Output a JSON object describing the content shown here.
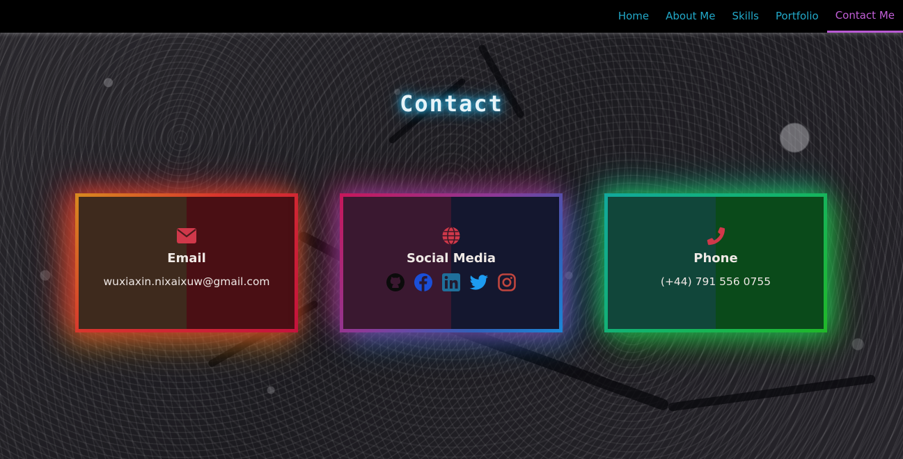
{
  "nav": {
    "items": [
      {
        "label": "Home",
        "active": false
      },
      {
        "label": "About Me",
        "active": false
      },
      {
        "label": "Skills",
        "active": false
      },
      {
        "label": "Portfolio",
        "active": false
      },
      {
        "label": "Contact Me",
        "active": true
      }
    ],
    "link_color": "#22a9c9",
    "active_color": "#c25fd8"
  },
  "page_title": "Contact",
  "cards": [
    {
      "id": "email",
      "icon": "envelope-icon",
      "title": "Email",
      "text": "wuxiaxin.nixaixuw@gmail.com"
    },
    {
      "id": "social",
      "icon": "globe-icon",
      "title": "Social Media",
      "links": [
        {
          "icon": "github-icon",
          "color": "#111111"
        },
        {
          "icon": "facebook-icon",
          "color": "#1a4fd8"
        },
        {
          "icon": "linkedin-icon",
          "color": "#1f6f9a"
        },
        {
          "icon": "twitter-icon",
          "color": "#1d9bf0"
        },
        {
          "icon": "instagram-icon",
          "color": "#c0453e"
        }
      ]
    },
    {
      "id": "phone",
      "icon": "phone-icon",
      "title": "Phone",
      "text": "(+44) 791 556 0755"
    }
  ],
  "icon_color": "#d0384a"
}
